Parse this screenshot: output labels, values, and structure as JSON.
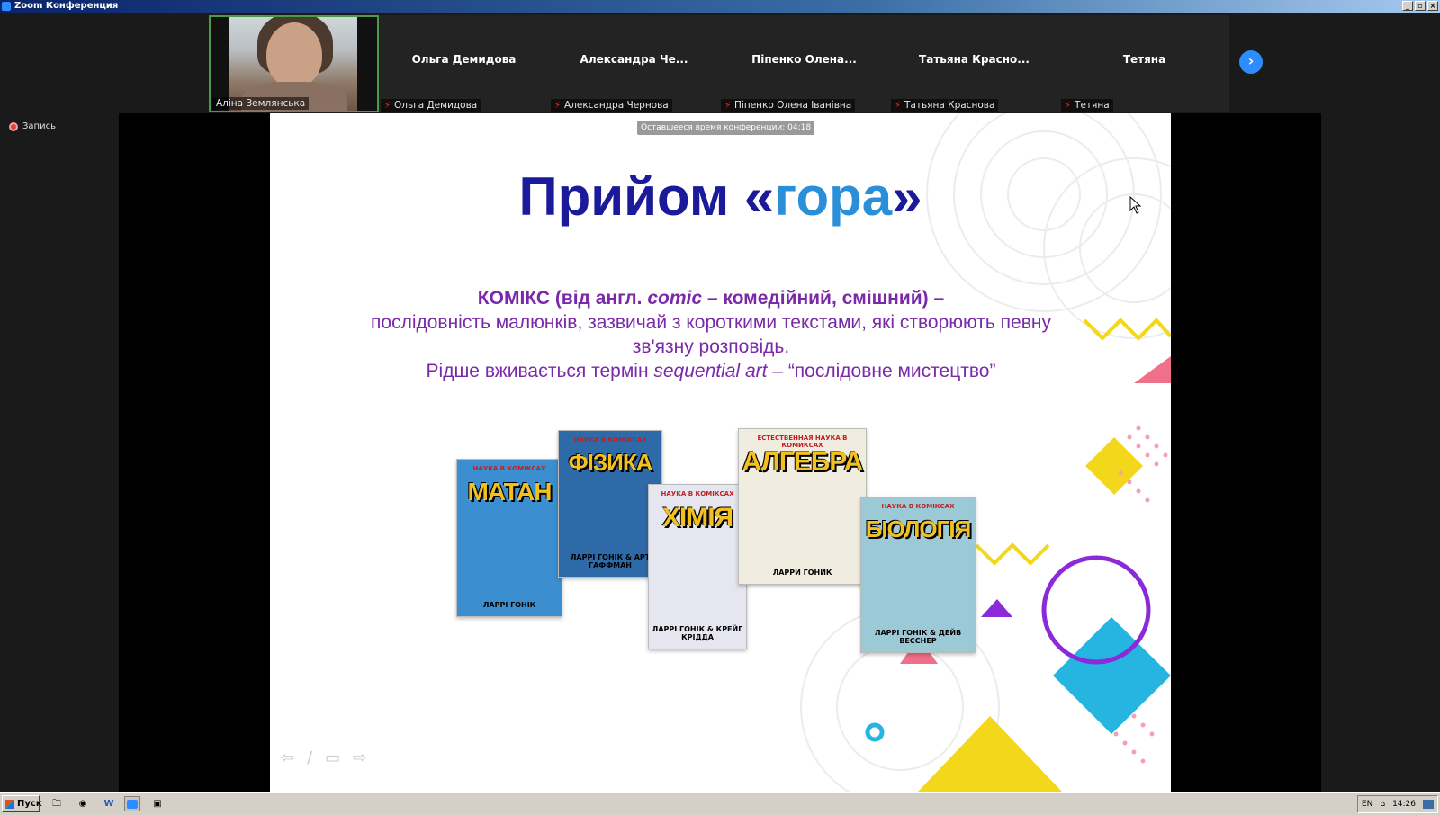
{
  "window": {
    "title": "Zoom Конференция"
  },
  "participants": [
    {
      "name": "Аліна Землянська",
      "caption": "Аліна Землянська",
      "video": true
    },
    {
      "name": "Ольга Демидова",
      "caption": "Ольга Демидова",
      "video": false
    },
    {
      "name": "Александра Че...",
      "caption": "Александра Чернова",
      "video": false
    },
    {
      "name": "Піпенко Олена...",
      "caption": "Піпенко Олена Іванівна",
      "video": false
    },
    {
      "name": "Татьяна Красно...",
      "caption": "Татьяна Краснова",
      "video": false
    },
    {
      "name": "Тетяна",
      "caption": "Тетяна",
      "video": false
    }
  ],
  "recording": {
    "label": "Запись"
  },
  "meeting": {
    "timer_text": "Оставшееся время конференции: 04:18"
  },
  "slide": {
    "title_main": "Прийом «",
    "title_accent": "гора",
    "title_end": "»",
    "def_bold_1": "КОМІКС (від англ. ",
    "def_bold_italic": "comic",
    "def_bold_2": " – комедійний, смішний) –",
    "def_line_2": "послідовність малюнків, зазвичай з короткими текстами, які створюють певну зв'язну розповідь.",
    "def_line_3a": "Рідше вживається термін ",
    "def_line_3_italic": "sequential art",
    "def_line_3b": " – “послідовне мистецтво”",
    "books": [
      {
        "series": "НАУКА В КОМІКСАХ",
        "title": "МАТАН",
        "author": "ЛАРРІ ГОНІК"
      },
      {
        "series": "НАУКА В КОМІКСАХ",
        "title": "ФІЗИКА",
        "author": "ЛАРРІ ГОНІК & АРТ ГАФФМАН"
      },
      {
        "series": "НАУКА В КОМІКСАХ",
        "title": "ХІМІЯ",
        "author": "ЛАРРІ ГОНІК & КРЕЙГ КРІДДА"
      },
      {
        "series": "ЕСТЕСТВЕННАЯ НАУКА В КОМИКСАХ",
        "title": "АЛГЕБРА",
        "author": "ЛАРРИ ГОНИК"
      },
      {
        "series": "НАУКА В КОМІКСАХ",
        "title": "БІОЛОГІЯ",
        "author": "ЛАРРІ ГОНІК & ДЕЙВ ВЕССНЕР"
      }
    ]
  },
  "taskbar": {
    "start_label": "Пуск",
    "lang": "EN",
    "time": "14:26"
  },
  "colors": {
    "zoom_blue": "#2d8cff",
    "title_dark_blue": "#1a1a9a",
    "title_accent": "#2a8fd8",
    "definition_purple": "#7a2aa8"
  }
}
